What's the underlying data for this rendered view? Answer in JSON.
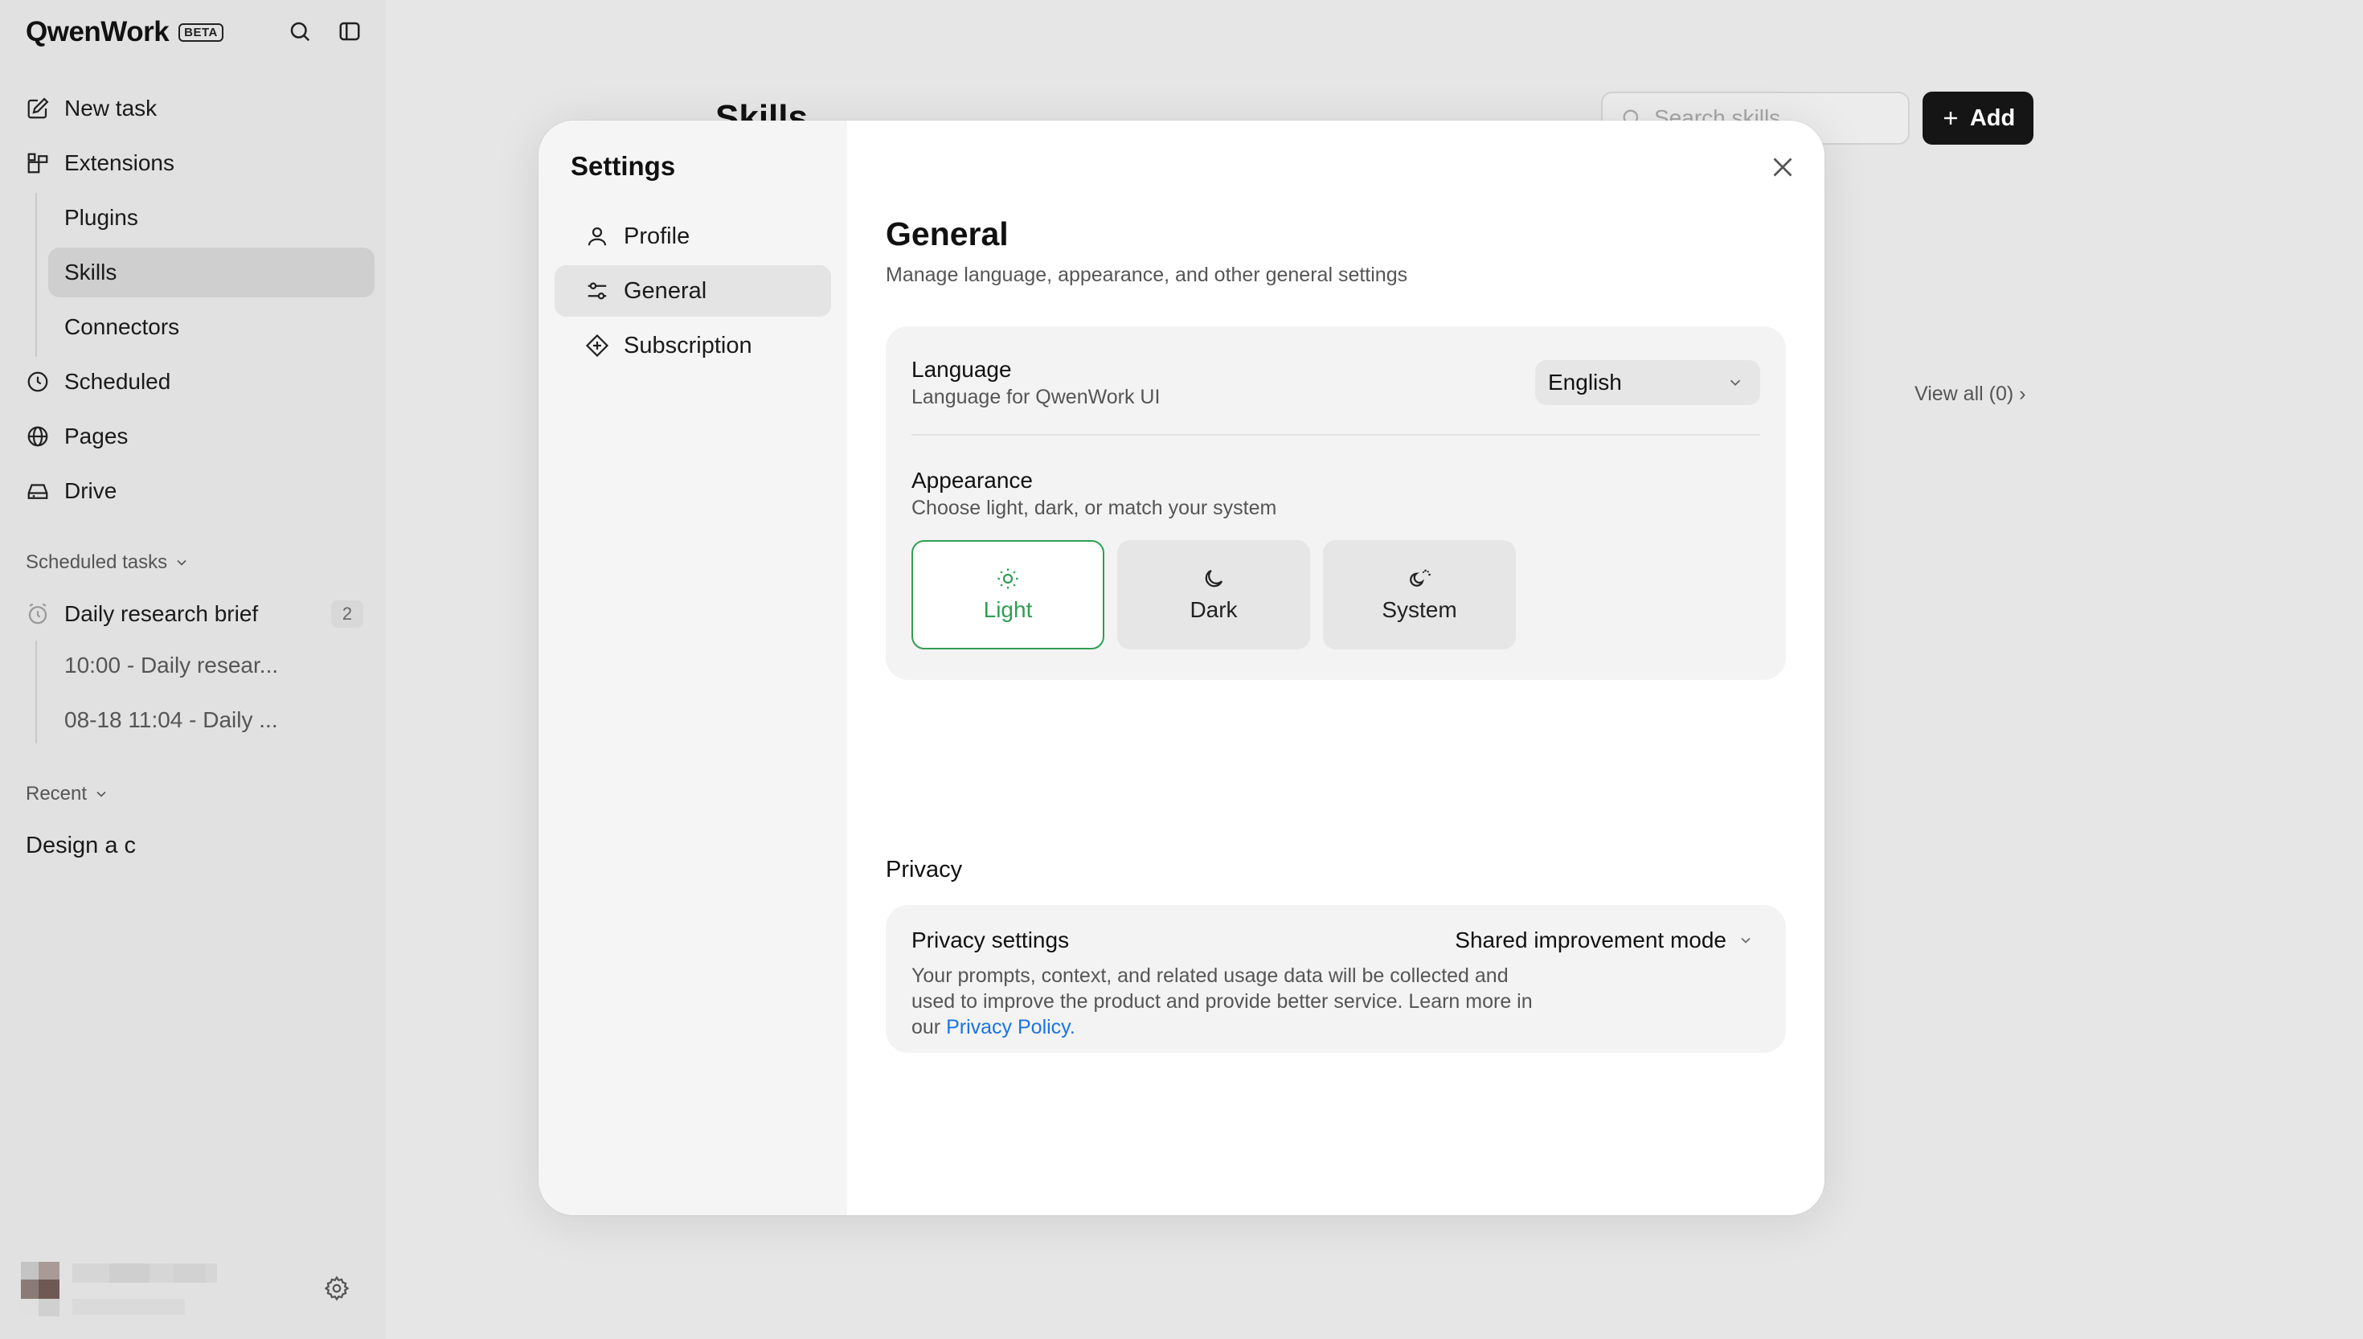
{
  "app": {
    "brand": "QwenWork",
    "badge": "BETA"
  },
  "sidebar": {
    "nav": {
      "new_task": "New task",
      "extensions": "Extensions",
      "plugins": "Plugins",
      "skills": "Skills",
      "connectors": "Connectors",
      "scheduled": "Scheduled",
      "pages": "Pages",
      "drive": "Drive"
    },
    "scheduled_tasks_label": "Scheduled tasks",
    "task": {
      "name": "Daily research brief",
      "count": "2",
      "runs": [
        "10:00 - Daily resear...",
        "08-18 11:04 - Daily ..."
      ]
    },
    "recent_label": "Recent",
    "recent_items": [
      "Design a c"
    ]
  },
  "background_page": {
    "title": "Skills",
    "search_placeholder": "Search skills",
    "add_label": "Add",
    "view_all": "View all (0) ›"
  },
  "settings": {
    "title": "Settings",
    "nav": {
      "profile": "Profile",
      "general": "General",
      "subscription": "Subscription"
    },
    "active_tab": "General",
    "general": {
      "heading": "General",
      "subheading": "Manage language, appearance, and other general settings",
      "language": {
        "title": "Language",
        "description": "Language for QwenWork UI",
        "value": "English"
      },
      "appearance": {
        "title": "Appearance",
        "description": "Choose light, dark, or match your system",
        "options": [
          "Light",
          "Dark",
          "System"
        ],
        "selected": "Light"
      },
      "privacy": {
        "section_label": "Privacy",
        "title": "Privacy settings",
        "description": "Your prompts, context, and related usage data will be collected and used to improve the product and provide better service. Learn more in our",
        "link_text": "Privacy Policy.",
        "mode": "Shared improvement mode"
      }
    }
  },
  "colors": {
    "accent_green": "#2f9e53",
    "link_blue": "#1a73e8",
    "add_button_bg": "#151515"
  }
}
